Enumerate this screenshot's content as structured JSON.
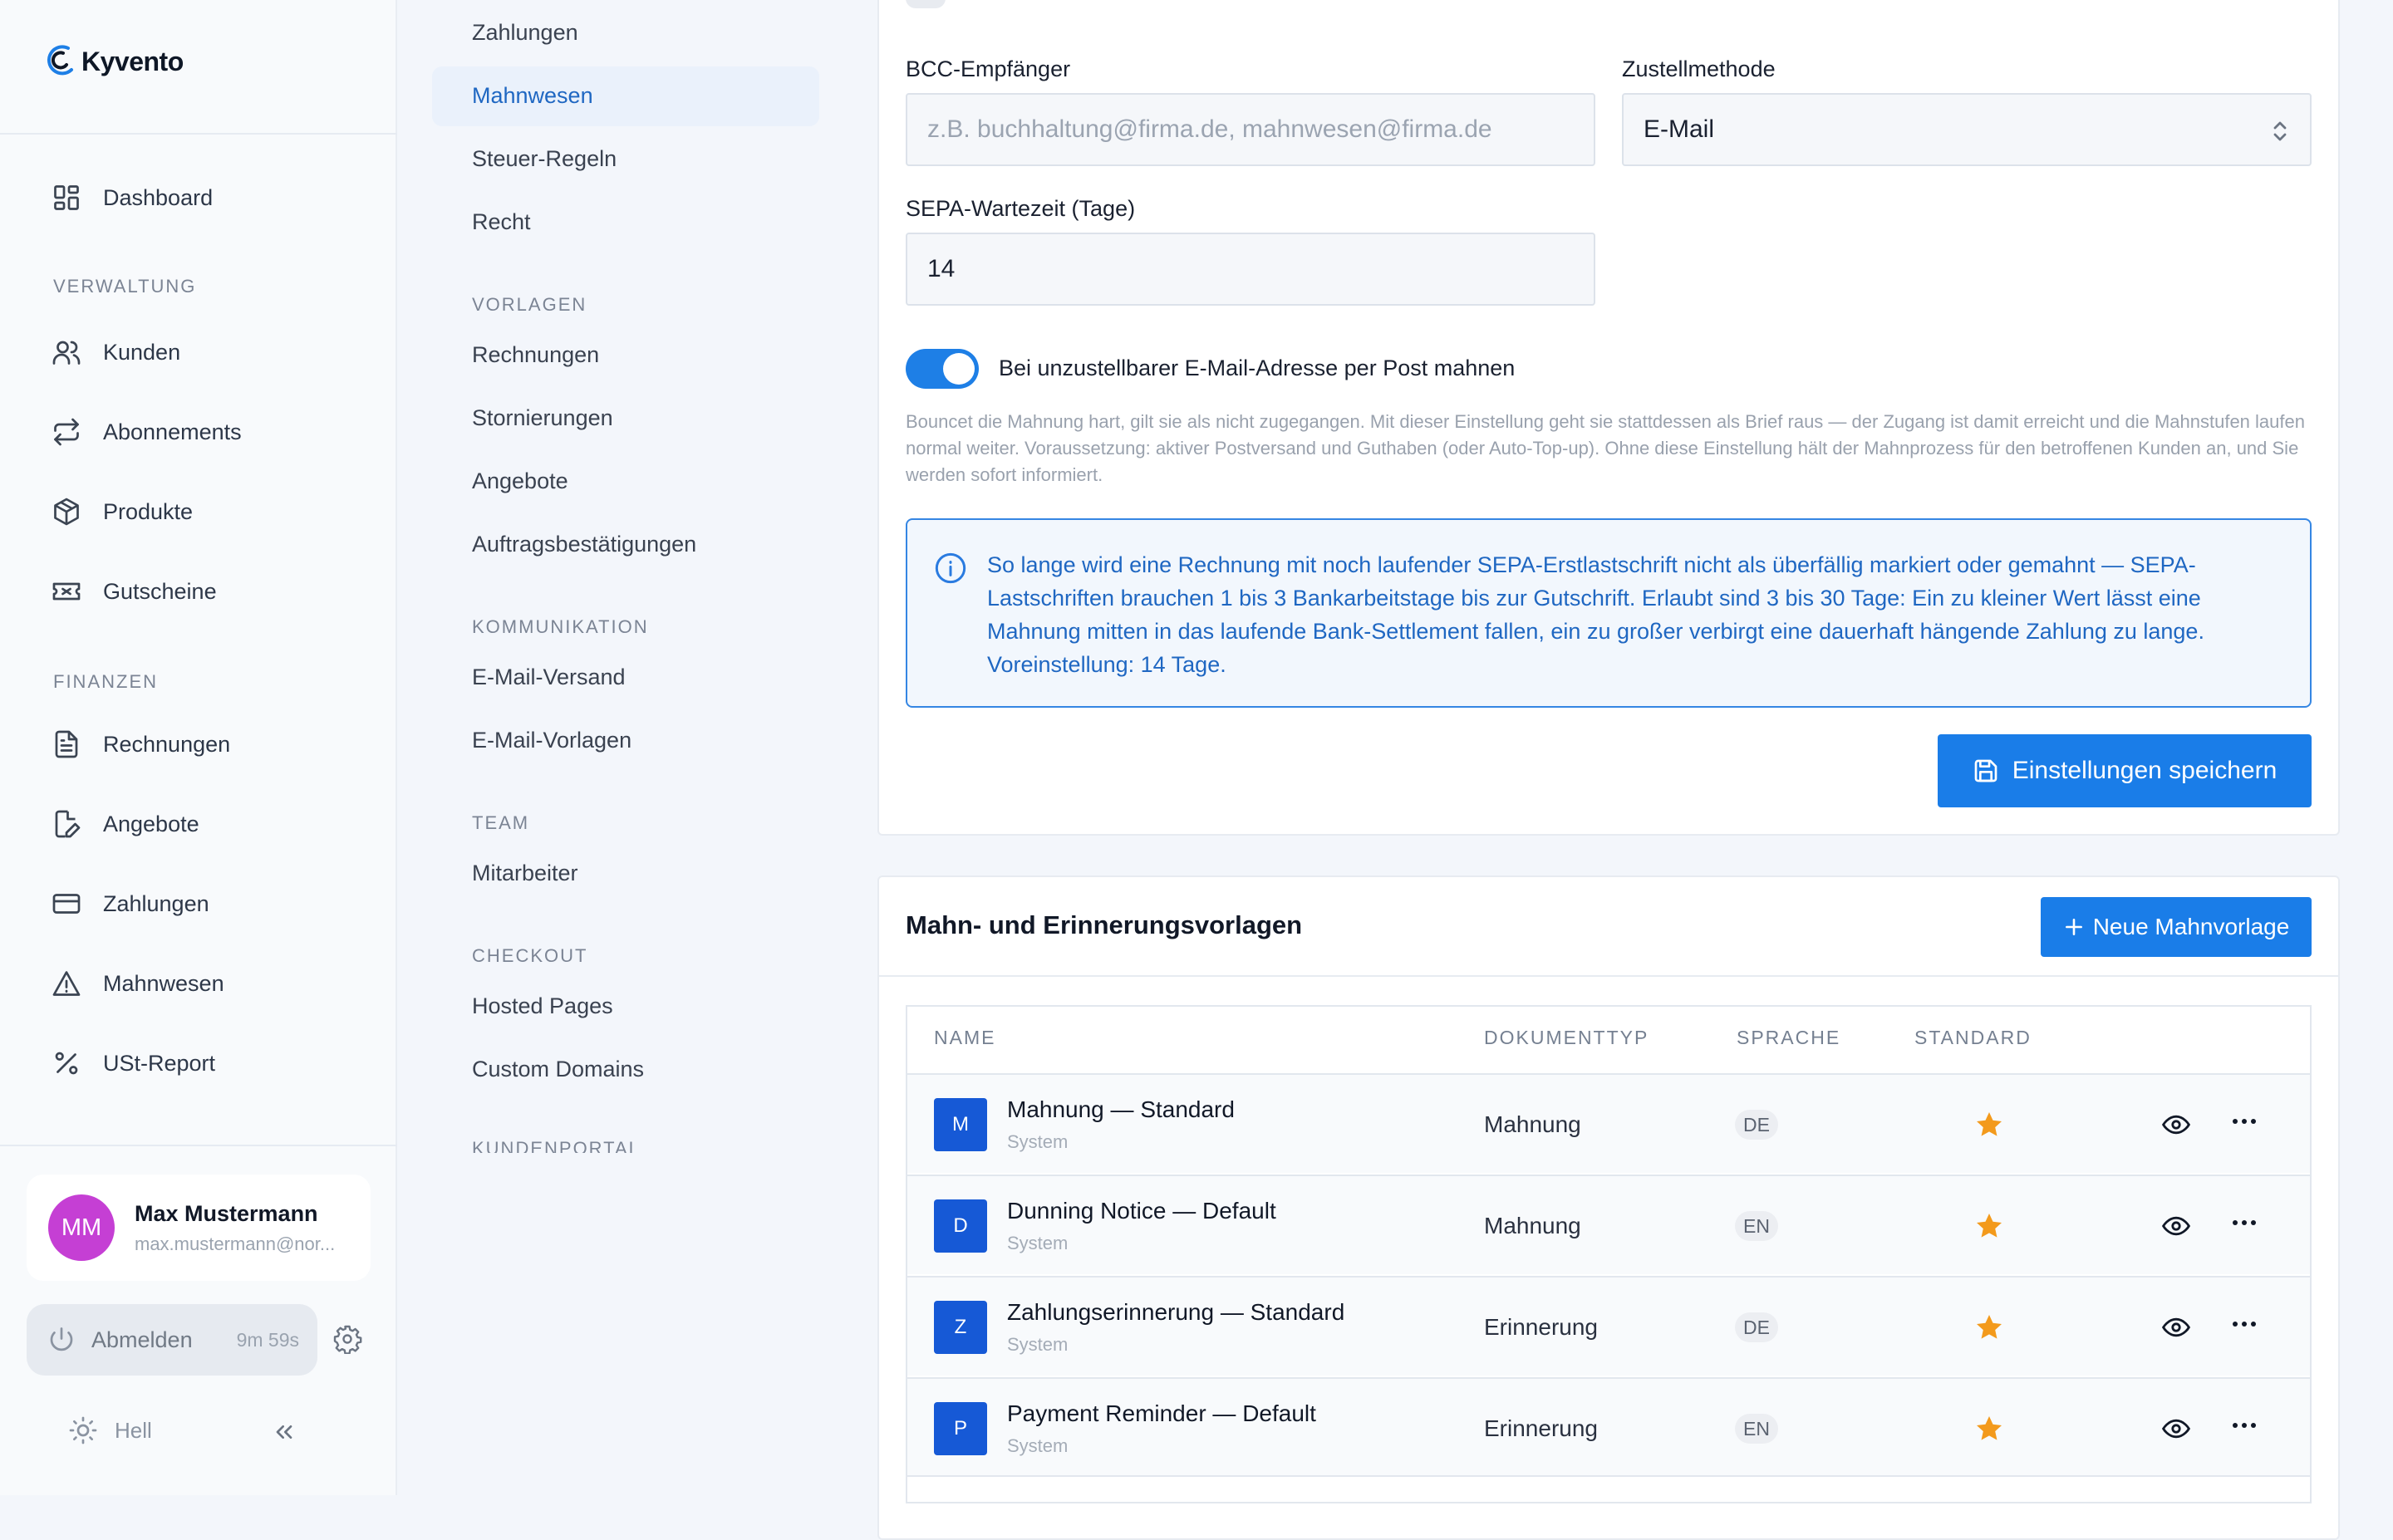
{
  "app": {
    "name": "Kyvento",
    "brand_color": "#1a7de8"
  },
  "sidebar": {
    "sections": [
      {
        "items": [
          {
            "label": "Dashboard",
            "icon": "dashboard-icon"
          }
        ]
      },
      {
        "heading": "VERWALTUNG",
        "items": [
          {
            "label": "Kunden",
            "icon": "users-icon"
          },
          {
            "label": "Abonnements",
            "icon": "repeat-icon"
          },
          {
            "label": "Produkte",
            "icon": "box-icon"
          },
          {
            "label": "Gutscheine",
            "icon": "ticket-icon"
          }
        ]
      },
      {
        "heading": "FINANZEN",
        "items": [
          {
            "label": "Rechnungen",
            "icon": "file-text-icon"
          },
          {
            "label": "Angebote",
            "icon": "file-edit-icon"
          },
          {
            "label": "Zahlungen",
            "icon": "credit-card-icon"
          },
          {
            "label": "Mahnwesen",
            "icon": "warning-icon"
          },
          {
            "label": "USt-Report",
            "icon": "percent-icon"
          }
        ]
      }
    ],
    "user": {
      "initials": "MM",
      "name": "Max Mustermann",
      "email": "max.mustermann@nor..."
    },
    "logout": {
      "label": "Abmelden",
      "timer": "9m 59s"
    },
    "theme_label": "Hell"
  },
  "subnav": {
    "items_top": [
      "Zahlungen",
      "Mahnwesen",
      "Steuer-Regeln",
      "Recht"
    ],
    "active": "Mahnwesen",
    "groups": [
      {
        "heading": "VORLAGEN",
        "items": [
          "Rechnungen",
          "Stornierungen",
          "Angebote",
          "Auftragsbestätigungen"
        ]
      },
      {
        "heading": "KOMMUNIKATION",
        "items": [
          "E-Mail-Versand",
          "E-Mail-Vorlagen"
        ]
      },
      {
        "heading": "TEAM",
        "items": [
          "Mitarbeiter"
        ]
      },
      {
        "heading": "CHECKOUT",
        "items": [
          "Hosted Pages",
          "Custom Domains"
        ]
      },
      {
        "heading": "KUNDENPORTAL",
        "items": []
      }
    ]
  },
  "settings": {
    "bcc_label": "BCC-Empfänger",
    "bcc_placeholder": "z.B. buchhaltung@firma.de, mahnwesen@firma.de",
    "delivery_label": "Zustellmethode",
    "delivery_value": "E-Mail",
    "sepa_label": "SEPA-Wartezeit (Tage)",
    "sepa_value": "14",
    "post_toggle_label": "Bei unzustellbarer E-Mail-Adresse per Post mahnen",
    "post_toggle_on": true,
    "post_help": "Bouncet die Mahnung hart, gilt sie als nicht zugegangen. Mit dieser Einstellung geht sie stattdessen als Brief raus — der Zugang ist damit erreicht und die Mahnstufen laufen normal weiter. Voraussetzung: aktiver Postversand und Guthaben (oder Auto-Top-up). Ohne diese Einstellung hält der Mahnprozess für den betroffenen Kunden an, und Sie werden sofort informiert.",
    "info_text": "So lange wird eine Rechnung mit noch laufender SEPA-Erstlastschrift nicht als überfällig markiert oder gemahnt — SEPA-Lastschriften brauchen 1 bis 3 Bankarbeitstage bis zur Gutschrift. Erlaubt sind 3 bis 30 Tage: Ein zu kleiner Wert lässt eine Mahnung mitten in das laufende Bank-Settlement fallen, ein zu großer verbirgt eine dauerhaft hängende Zahlung zu lange. Voreinstellung: 14 Tage.",
    "save_label": "Einstellungen speichern"
  },
  "templates": {
    "title": "Mahn- und Erinnerungsvorlagen",
    "new_label": "Neue Mahnvorlage",
    "columns": [
      "NAME",
      "DOKUMENTTYP",
      "SPRACHE",
      "STANDARD"
    ],
    "rows": [
      {
        "initial": "M",
        "name": "Mahnung — Standard",
        "source": "System",
        "type": "Mahnung",
        "lang": "DE",
        "default": true
      },
      {
        "initial": "D",
        "name": "Dunning Notice — Default",
        "source": "System",
        "type": "Mahnung",
        "lang": "EN",
        "default": true
      },
      {
        "initial": "Z",
        "name": "Zahlungserinnerung — Standard",
        "source": "System",
        "type": "Erinnerung",
        "lang": "DE",
        "default": true
      },
      {
        "initial": "P",
        "name": "Payment Reminder — Default",
        "source": "System",
        "type": "Erinnerung",
        "lang": "EN",
        "default": true
      }
    ]
  }
}
